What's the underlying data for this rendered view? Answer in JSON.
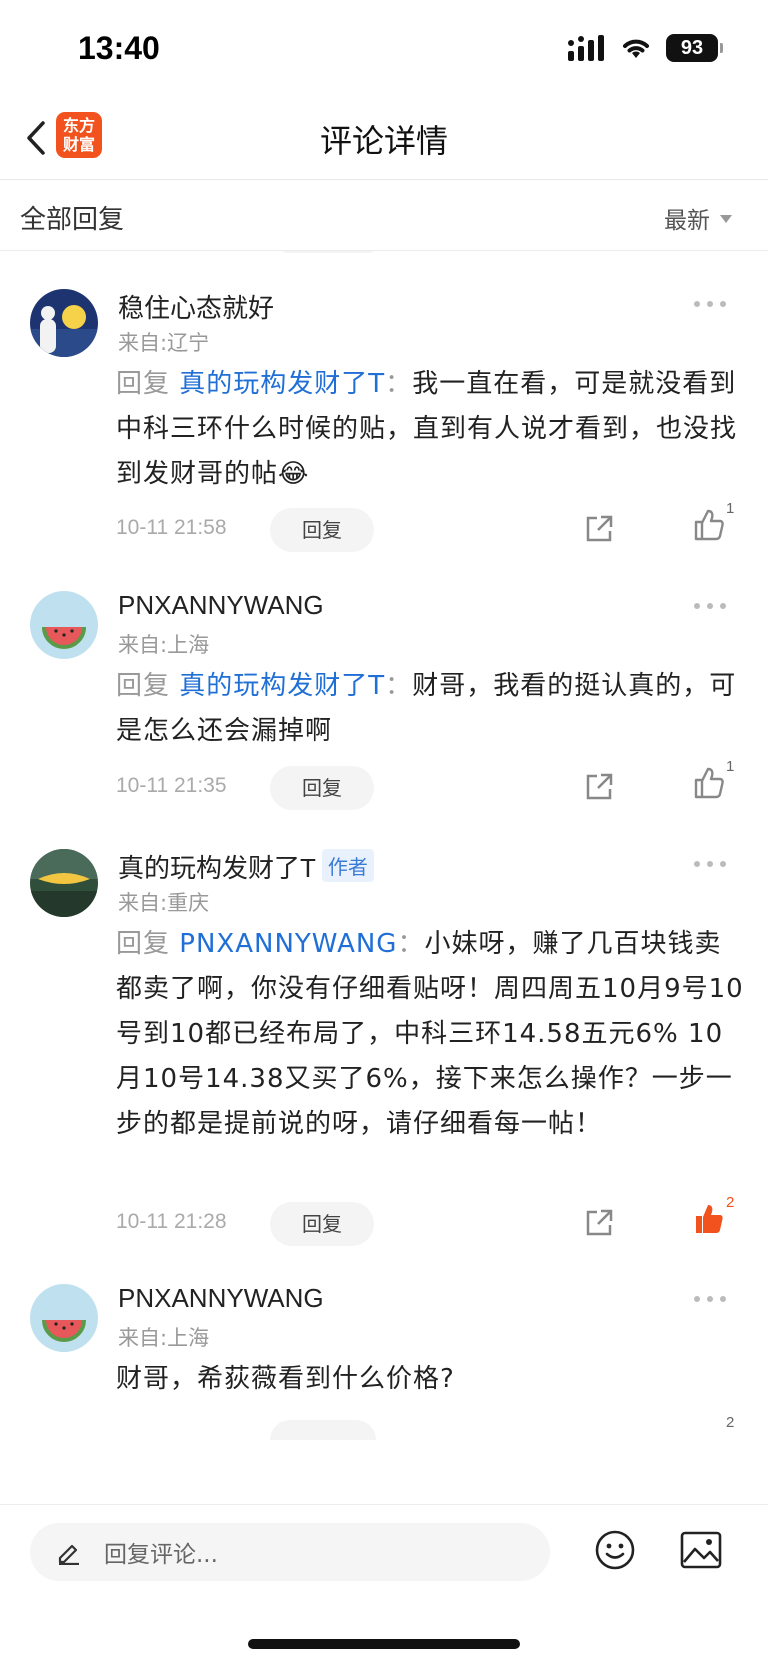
{
  "status": {
    "time": "13:40",
    "battery": "93"
  },
  "nav": {
    "logo_text": "东方财富",
    "title": "评论详情"
  },
  "sort": {
    "title": "全部回复",
    "selected": "最新"
  },
  "comments": [
    {
      "name": "稳住心态就好",
      "location": "来自:辽宁",
      "reply_prefix": "回复",
      "reply_target": "真的玩构发财了T",
      "text": "我一直在看，可是就没看到中科三环什么时候的贴，直到有人说才看到，也没找到发财哥的帖😂",
      "time": "10-11 21:58",
      "reply_label": "回复",
      "likes": "1",
      "liked": false
    },
    {
      "name": "PNXANNYWANG",
      "location": "来自:上海",
      "reply_prefix": "回复",
      "reply_target": "真的玩构发财了T",
      "text": "财哥，我看的挺认真的，可是怎么还会漏掉啊",
      "time": "10-11 21:35",
      "reply_label": "回复",
      "likes": "1",
      "liked": false
    },
    {
      "name": "真的玩构发财了T",
      "author_badge": "作者",
      "location": "来自:重庆",
      "reply_prefix": "回复",
      "reply_target": "PNXANNYWANG",
      "text": "小妹呀，赚了几百块钱卖都卖了啊，你没有仔细看贴呀！周四周五10月9号10号到10都已经布局了，中科三环14.58五元6% 10月10号14.38又买了6%，接下来怎么操作？一步一步的都是提前说的呀，请仔细看每一帖！",
      "time": "10-11 21:28",
      "reply_label": "回复",
      "likes": "2",
      "liked": true
    },
    {
      "name": "PNXANNYWANG",
      "location": "来自:上海",
      "text": "财哥，希荻薇看到什么价格?",
      "likes": "2"
    }
  ],
  "bottom": {
    "input_placeholder": "回复评论..."
  },
  "colors": {
    "accent": "#f2521d",
    "link": "#1f6fd6"
  }
}
